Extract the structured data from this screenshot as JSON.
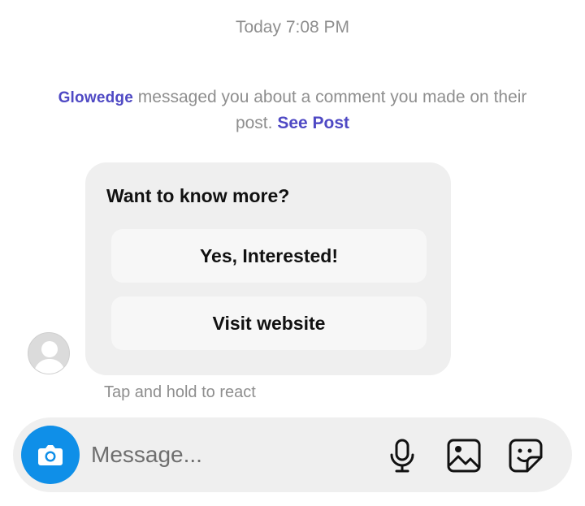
{
  "timestamp": "Today 7:08 PM",
  "notice": {
    "brand": "Glowedge",
    "text": " messaged you about a comment you made on their post. ",
    "link": "See Post"
  },
  "card": {
    "title": "Want to know more?",
    "buttons": [
      {
        "label": "Yes, Interested!"
      },
      {
        "label": "Visit website"
      }
    ]
  },
  "hint": "Tap and hold to react",
  "composer": {
    "placeholder": "Message...",
    "value": "",
    "icons": [
      "camera-icon",
      "microphone-icon",
      "image-icon",
      "sticker-icon"
    ]
  },
  "colors": {
    "brand": "#4f49c4",
    "camera": "#0f8fe8",
    "muted": "#8e8e8e",
    "bubble": "#efefef"
  }
}
